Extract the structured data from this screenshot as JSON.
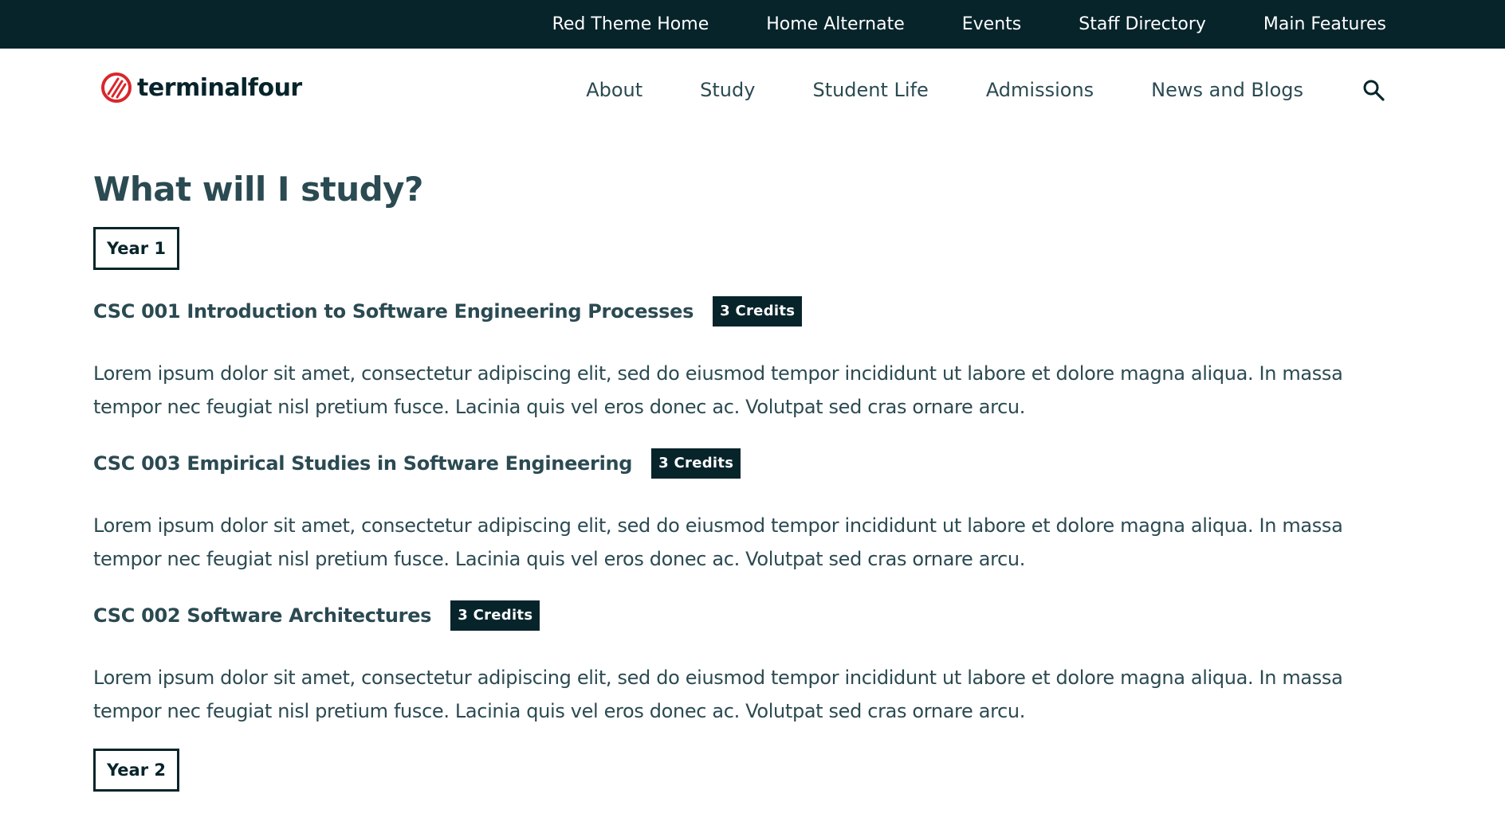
{
  "topbar": {
    "links": [
      {
        "label": "Red Theme Home"
      },
      {
        "label": "Home Alternate"
      },
      {
        "label": "Events"
      },
      {
        "label": "Staff Directory"
      },
      {
        "label": "Main Features"
      }
    ]
  },
  "header": {
    "logo_text": "terminalfour",
    "nav": [
      {
        "label": "About"
      },
      {
        "label": "Study"
      },
      {
        "label": "Student Life"
      },
      {
        "label": "Admissions"
      },
      {
        "label": "News and Blogs"
      }
    ],
    "search_icon": "search-icon"
  },
  "colors": {
    "dark": "#07242b",
    "text": "#2b4a52",
    "logo_accent": "#d9262c"
  },
  "main": {
    "title": "What will I study?",
    "years": [
      {
        "label": "Year 1",
        "courses": [
          {
            "title": "CSC 001 Introduction to Software Engineering Processes",
            "credits": "3 Credits",
            "description": "Lorem ipsum dolor sit amet, consectetur adipiscing elit, sed do eiusmod tempor incididunt ut labore et dolore magna aliqua. In massa tempor nec feugiat nisl pretium fusce. Lacinia quis vel eros donec ac. Volutpat sed cras ornare arcu."
          },
          {
            "title": "CSC 003 Empirical Studies in Software Engineering",
            "credits": "3 Credits",
            "description": "Lorem ipsum dolor sit amet, consectetur adipiscing elit, sed do eiusmod tempor incididunt ut labore et dolore magna aliqua. In massa tempor nec feugiat nisl pretium fusce. Lacinia quis vel eros donec ac. Volutpat sed cras ornare arcu."
          },
          {
            "title": "CSC 002 Software Architectures",
            "credits": "3 Credits",
            "description": "Lorem ipsum dolor sit amet, consectetur adipiscing elit, sed do eiusmod tempor incididunt ut labore et dolore magna aliqua. In massa tempor nec feugiat nisl pretium fusce. Lacinia quis vel eros donec ac. Volutpat sed cras ornare arcu."
          }
        ]
      },
      {
        "label": "Year 2",
        "courses": []
      }
    ]
  }
}
